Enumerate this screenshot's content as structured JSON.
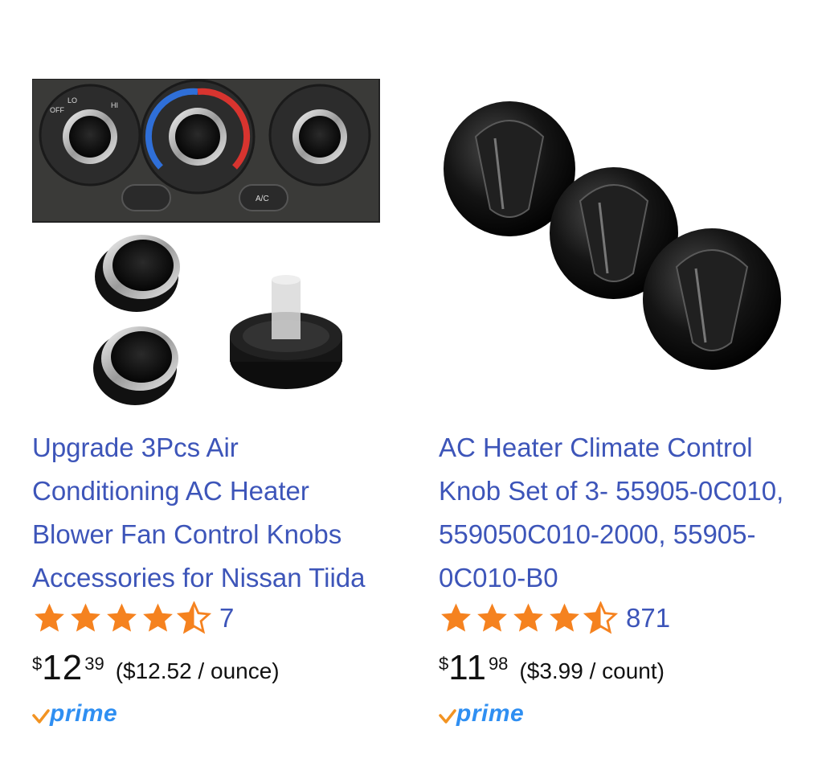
{
  "products": [
    {
      "title": "Upgrade 3Pcs Air Conditioning AC Heater Blower Fan Control Knobs Accessories for Nissan Tiida",
      "rating": 4.5,
      "review_count": "7",
      "price": {
        "symbol": "$",
        "whole": "12",
        "fraction": "39"
      },
      "unit_price": "($12.52 / ounce)",
      "prime": "prime",
      "panel_labels": [
        "OFF",
        "LO",
        "HI",
        "A/C"
      ]
    },
    {
      "title": "AC Heater Climate Control Knob Set of 3- 55905-0C010, 559050C010-2000, 55905-0C010-B0",
      "rating": 4.5,
      "review_count": "871",
      "price": {
        "symbol": "$",
        "whole": "11",
        "fraction": "98"
      },
      "unit_price": "($3.99 / count)",
      "prime": "prime"
    }
  ],
  "colors": {
    "link": "#3d55b9",
    "star": "#f5821f",
    "prime": "#2f8ff2",
    "prime_check": "#f29322"
  },
  "icons": [
    "star-full-icon",
    "star-half-icon",
    "prime-check-icon"
  ]
}
